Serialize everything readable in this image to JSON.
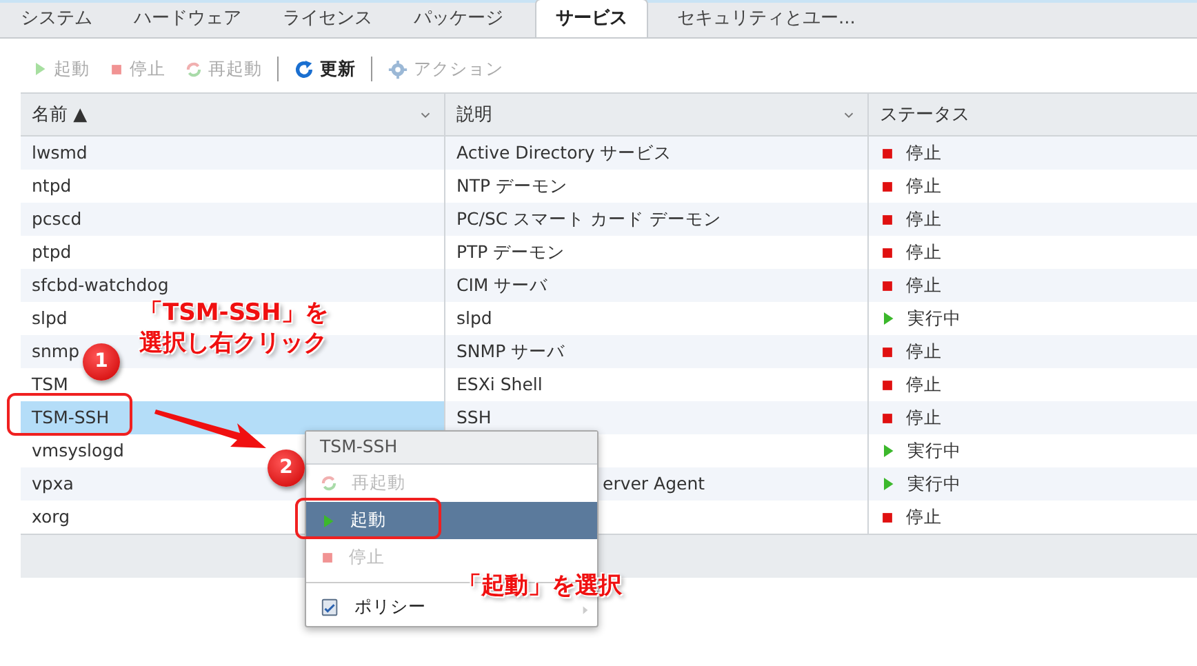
{
  "tabs": [
    {
      "label": "システム",
      "selected": false
    },
    {
      "label": "ハードウェア",
      "selected": false
    },
    {
      "label": "ライセンス",
      "selected": false
    },
    {
      "label": "パッケージ",
      "selected": false
    },
    {
      "label": "サービス",
      "selected": true
    },
    {
      "label": "セキュリティとユー...",
      "selected": false
    }
  ],
  "toolbar": [
    {
      "kind": "start",
      "label": "起動",
      "disabled": true
    },
    {
      "kind": "stop",
      "label": "停止",
      "disabled": true
    },
    {
      "kind": "restart",
      "label": "再起動",
      "disabled": true
    },
    {
      "kind": "separator"
    },
    {
      "kind": "refresh",
      "label": "更新",
      "disabled": false
    },
    {
      "kind": "separator"
    },
    {
      "kind": "actions",
      "label": "アクション",
      "disabled": true
    }
  ],
  "table": {
    "columns": [
      {
        "label": "名前",
        "sort": "▲",
        "menu": true
      },
      {
        "label": "説明",
        "menu": true
      },
      {
        "label": "ステータス",
        "menu": false
      }
    ],
    "rows": [
      {
        "name": "lwsmd",
        "description": "Active Directory サービス",
        "kind": "stopped",
        "status_text": "停止",
        "selected": false
      },
      {
        "name": "ntpd",
        "description": "NTP デーモン",
        "kind": "stopped",
        "status_text": "停止",
        "selected": false
      },
      {
        "name": "pcscd",
        "description": "PC/SC スマート カード デーモン",
        "kind": "stopped",
        "status_text": "停止",
        "selected": false
      },
      {
        "name": "ptpd",
        "description": "PTP デーモン",
        "kind": "stopped",
        "status_text": "停止",
        "selected": false
      },
      {
        "name": "sfcbd-watchdog",
        "description": "CIM サーバ",
        "kind": "stopped",
        "status_text": "停止",
        "selected": false
      },
      {
        "name": "slpd",
        "description": "slpd",
        "kind": "running",
        "status_text": "実行中",
        "selected": false
      },
      {
        "name": "snmp",
        "description": "SNMP サーバ",
        "kind": "stopped",
        "status_text": "停止",
        "selected": false
      },
      {
        "name": "TSM",
        "description": "ESXi Shell",
        "kind": "stopped",
        "status_text": "停止",
        "selected": false
      },
      {
        "name": "TSM-SSH",
        "description": "SSH",
        "kind": "stopped",
        "status_text": "停止",
        "selected": true
      },
      {
        "name": "vmsyslogd",
        "kind": "running",
        "status_text": "実行中",
        "selected": false
      },
      {
        "name": "vpxa",
        "description": "erver Agent",
        "description_tail_only": true,
        "kind": "running",
        "status_text": "実行中",
        "selected": false
      },
      {
        "name": "xorg",
        "kind": "stopped",
        "status_text": "停止",
        "selected": false
      }
    ]
  },
  "context_menu": {
    "title": "TSM-SSH",
    "items": [
      {
        "kind": "restart",
        "label": "再起動",
        "disabled": true,
        "selected": false
      },
      {
        "kind": "start",
        "label": "起動",
        "disabled": false,
        "selected": true
      },
      {
        "kind": "stop",
        "label": "停止",
        "disabled": true,
        "selected": false
      },
      {
        "kind": "separator"
      },
      {
        "kind": "policy",
        "label": "ポリシー",
        "disabled": false,
        "selected": false,
        "submenu": true
      }
    ]
  },
  "annotations": [
    {
      "kind": "callout",
      "lines": [
        "「TSM-SSH」を",
        "選択し右クリック"
      ]
    },
    {
      "kind": "step",
      "text": "1"
    },
    {
      "kind": "highlight"
    },
    {
      "kind": "arrow"
    },
    {
      "kind": "step",
      "text": "2"
    },
    {
      "kind": "highlight"
    },
    {
      "kind": "callout",
      "lines": [
        "「起動」を選択"
      ]
    }
  ]
}
